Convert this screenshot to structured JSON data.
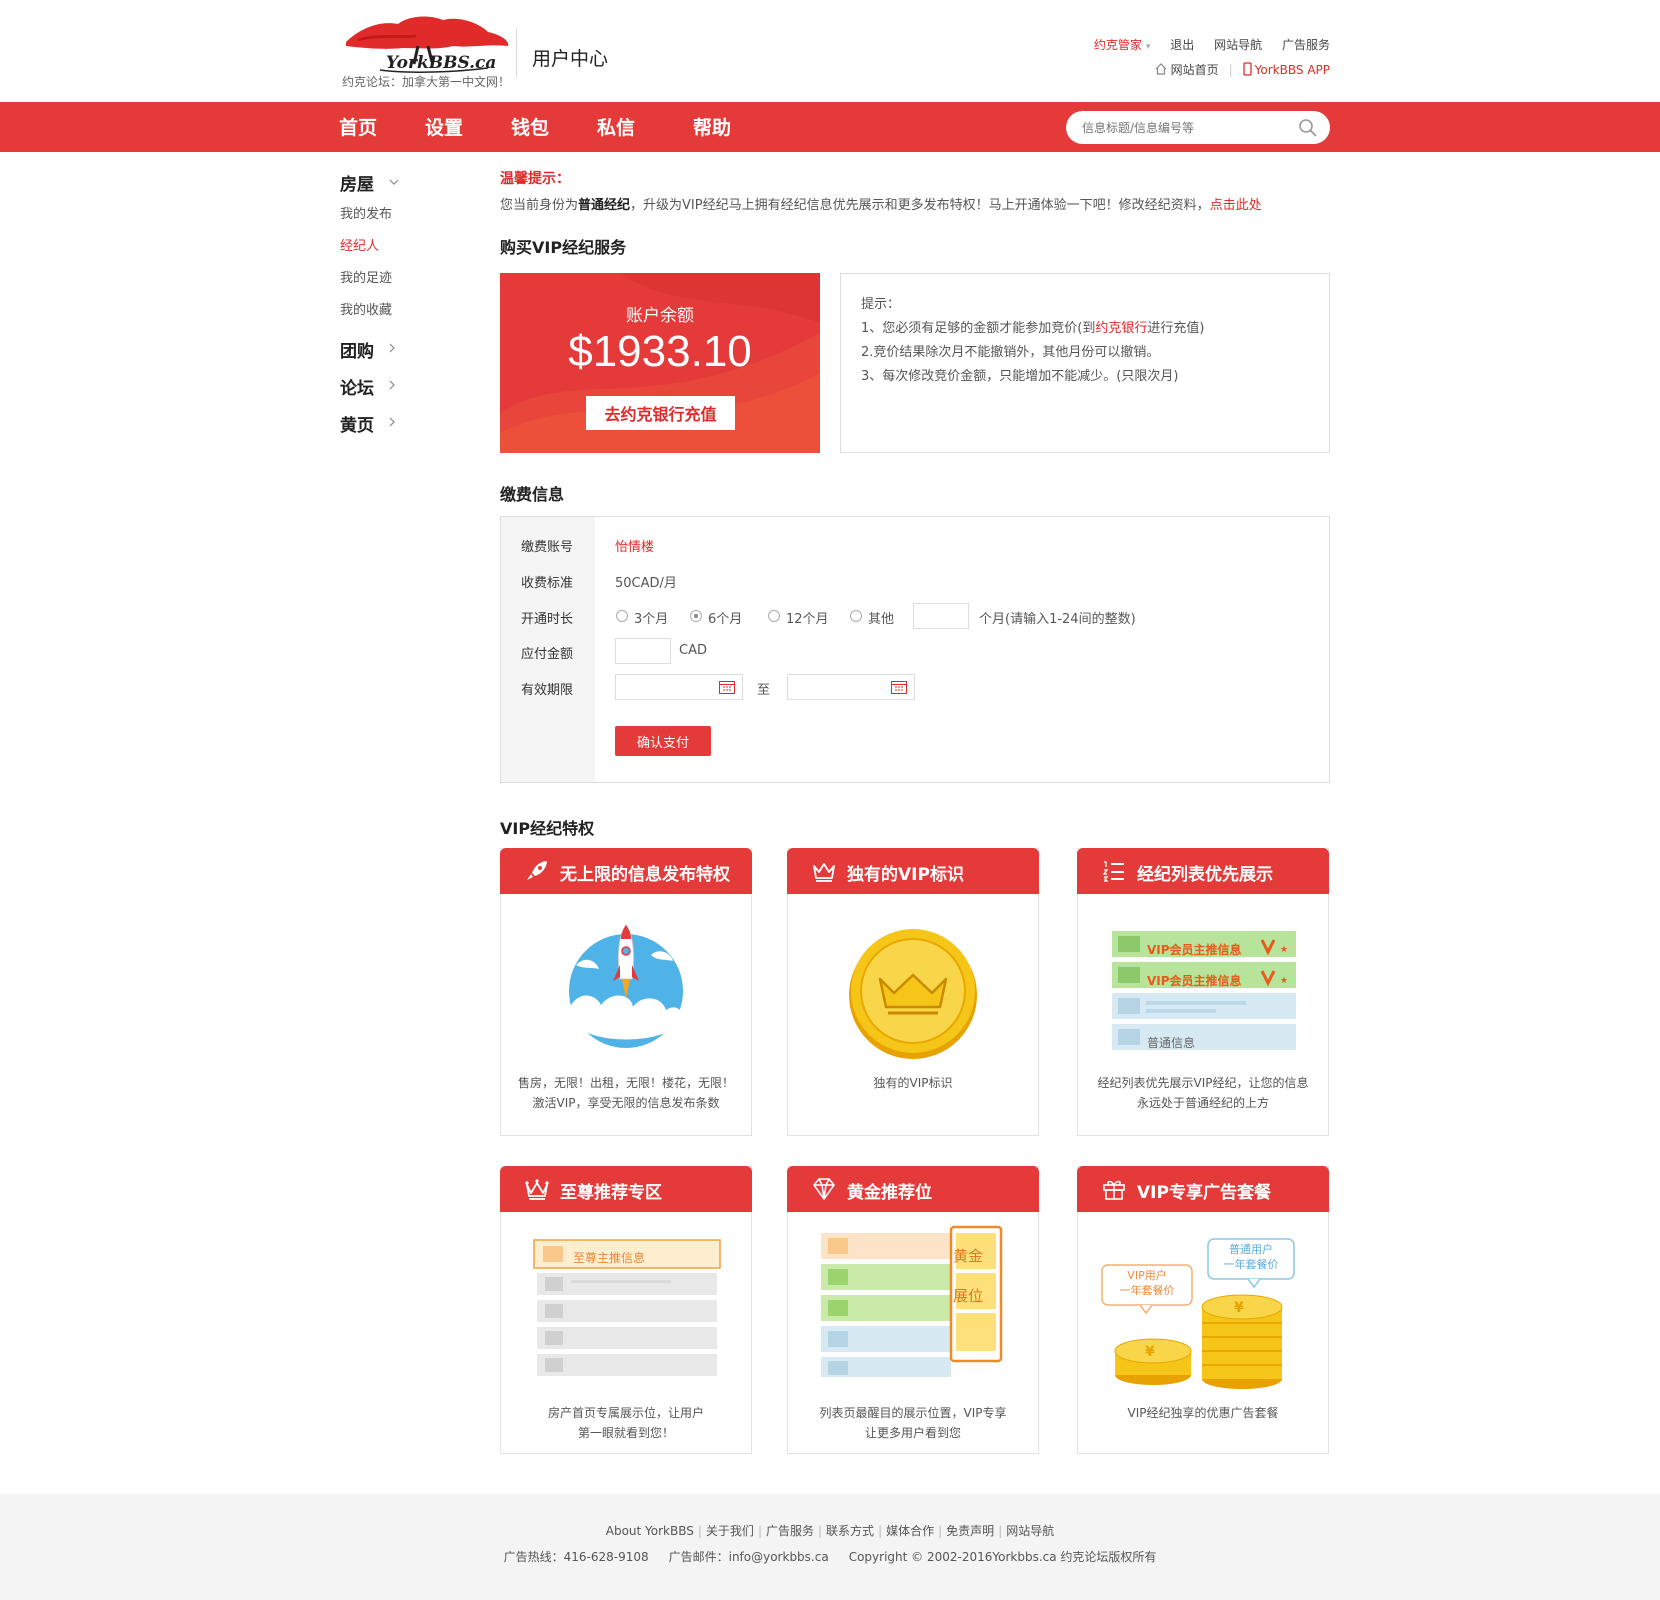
{
  "header": {
    "logo_text": "YorkBBS.ca",
    "logo_sub": "约克论坛：加拿大第一中文网！",
    "title": "用户中心",
    "top_links": [
      "约克管家",
      "退出",
      "网站导航",
      "广告服务"
    ],
    "home_link": "网站首页",
    "app_link": "YorkBBS APP"
  },
  "nav": {
    "items": [
      "首页",
      "设置",
      "钱包",
      "私信",
      "帮助"
    ],
    "search_placeholder": "信息标题/信息编号等"
  },
  "sidebar": {
    "sections": [
      {
        "label": "房屋",
        "children": [
          "我的发布",
          "经纪人",
          "我的足迹",
          "我的收藏"
        ],
        "active_child": "经纪人"
      },
      {
        "label": "团购"
      },
      {
        "label": "论坛"
      },
      {
        "label": "黄页"
      }
    ]
  },
  "notice": {
    "label": "温馨提示：",
    "pre": "您当前身份为",
    "status": "普通经纪",
    "mid": "，升级为VIP经纪马上拥有经纪信息优先展示和更多发布特权！马上开通体验一下吧！修改经纪资料，",
    "link": "点击此处"
  },
  "buy_section": {
    "title": "购买VIP经纪服务",
    "balance_label": "账户余额",
    "balance_amount": "$1933.10",
    "recharge_button": "去约克银行充值",
    "hint_title": "提示：",
    "hint1_pre": "1、您必须有足够的金额才能参加竞价(到",
    "hint1_link": "约克银行",
    "hint1_post": "进行充值)",
    "hint2": "2.竞价结果除次月不能撤销外，其他月份可以撤销。",
    "hint3": "3、每次修改竞价金额，只能增加不能减少。(只限次月)"
  },
  "payment": {
    "title": "缴费信息",
    "labels": {
      "account": "缴费账号",
      "standard": "收费标准",
      "duration": "开通时长",
      "amount": "应付金额",
      "validity": "有效期限"
    },
    "account_value": "怡情楼",
    "standard_value": "50CAD/月",
    "duration_options": [
      "3个月",
      "6个月",
      "12个月",
      "其他"
    ],
    "selected_duration": "6个月",
    "duration_suffix": "个月(请输入1-24间的整数)",
    "amount_unit": "CAD",
    "validity_to": "至",
    "confirm_button": "确认支付"
  },
  "privileges": {
    "title": "VIP经纪特权",
    "cards": [
      {
        "title": "无上限的信息发布特权",
        "icon": "rocket-icon",
        "desc1": "售房，无限！出租，无限！楼花，无限！",
        "desc2": "激活VIP，享受无限的信息发布条数"
      },
      {
        "title": "独有的VIP标识",
        "icon": "crown-icon",
        "desc1": "独有的VIP标识",
        "desc2": ""
      },
      {
        "title": "经纪列表优先展示",
        "icon": "list-icon",
        "desc1": "经纪列表优先展示VIP经纪，让您的信息",
        "desc2": "永远处于普通经纪的上方",
        "art_row1": "VIP会员主推信息",
        "art_row2": "VIP会员主推信息",
        "art_row4": "普通信息"
      },
      {
        "title": "至尊推荐专区",
        "icon": "queen-crown-icon",
        "desc1": "房产首页专属展示位，让用户",
        "desc2": "第一眼就看到您！",
        "art_row1": "至尊主推信息"
      },
      {
        "title": "黄金推荐位",
        "icon": "diamond-icon",
        "desc1": "列表页最醒目的展示位置，VIP专享",
        "desc2": "让更多用户看到您",
        "art_gold1": "黄金",
        "art_gold2": "展位"
      },
      {
        "title": "VIP专享广告套餐",
        "icon": "gift-icon",
        "desc1": "VIP经纪独享的优惠广告套餐",
        "desc2": "",
        "art_bubble1a": "VIP用户",
        "art_bubble1b": "一年套餐价",
        "art_bubble2a": "普通用户",
        "art_bubble2b": "一年套餐价"
      }
    ]
  },
  "footer": {
    "links": [
      "About YorkBBS",
      "关于我们",
      "广告服务",
      "联系方式",
      "媒体合作",
      "免责声明",
      "网站导航"
    ],
    "hotline": "广告热线：416-628-9108",
    "email": "广告邮件：info@yorkbbs.ca",
    "copyright": "Copyright © 2002-2016Yorkbbs.ca 约克论坛版权所有"
  },
  "colors": {
    "brand_red": "#e43a3a",
    "link_red": "#e12b2b",
    "gold": "#f5b400"
  }
}
